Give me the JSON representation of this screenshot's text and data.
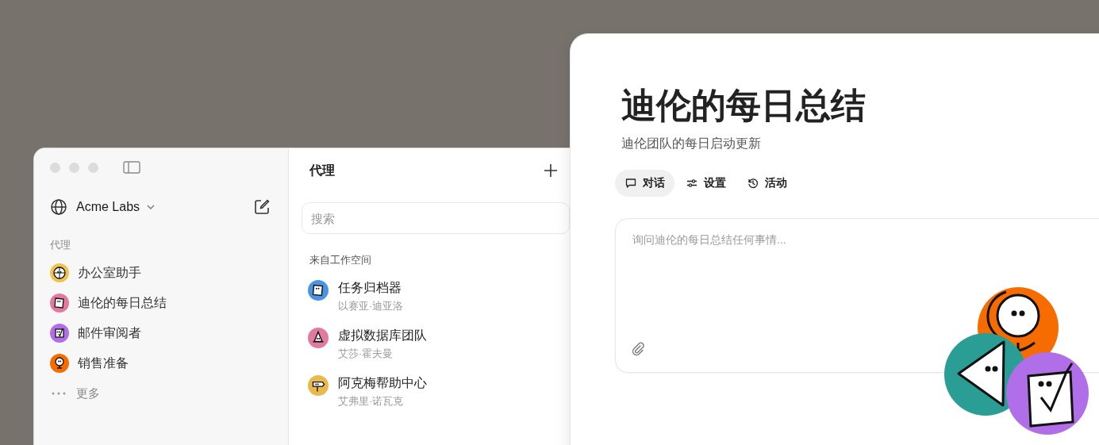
{
  "sidebar": {
    "workspace": "Acme Labs",
    "section_label": "代理",
    "items": [
      {
        "label": "办公室助手",
        "kind": "globe",
        "color": "#f0c44c"
      },
      {
        "label": "迪伦的每日总结",
        "kind": "note",
        "color": "#e2799f"
      },
      {
        "label": "邮件审阅者",
        "kind": "check",
        "color": "#b06ee8"
      },
      {
        "label": "销售准备",
        "kind": "magnifier",
        "color": "#f76c00"
      }
    ],
    "more": "更多"
  },
  "agents_panel": {
    "title": "代理",
    "search": {
      "placeholder": "搜索"
    },
    "section_label": "来自工作空间",
    "items": [
      {
        "name": "任务归档器",
        "owner": "以赛亚·迪亚洛",
        "kind": "note",
        "color": "#4a94e4"
      },
      {
        "name": "虚拟数据库团队",
        "owner": "艾莎·霍夫曼",
        "kind": "hat",
        "color": "#e2799f"
      },
      {
        "name": "阿克梅帮助中心",
        "owner": "艾弗里·诺瓦克",
        "kind": "sign",
        "color": "#e9b94c"
      }
    ]
  },
  "agent": {
    "title": "迪伦的每日总结",
    "subtitle": "迪伦团队的每日启动更新",
    "tabs": [
      {
        "label": "对话",
        "kind": "chat",
        "selected": true
      },
      {
        "label": "设置",
        "kind": "sliders",
        "selected": false
      },
      {
        "label": "活动",
        "kind": "history",
        "selected": false
      }
    ],
    "message": {
      "placeholder": "询问迪伦的每日总结任何事情..."
    }
  }
}
